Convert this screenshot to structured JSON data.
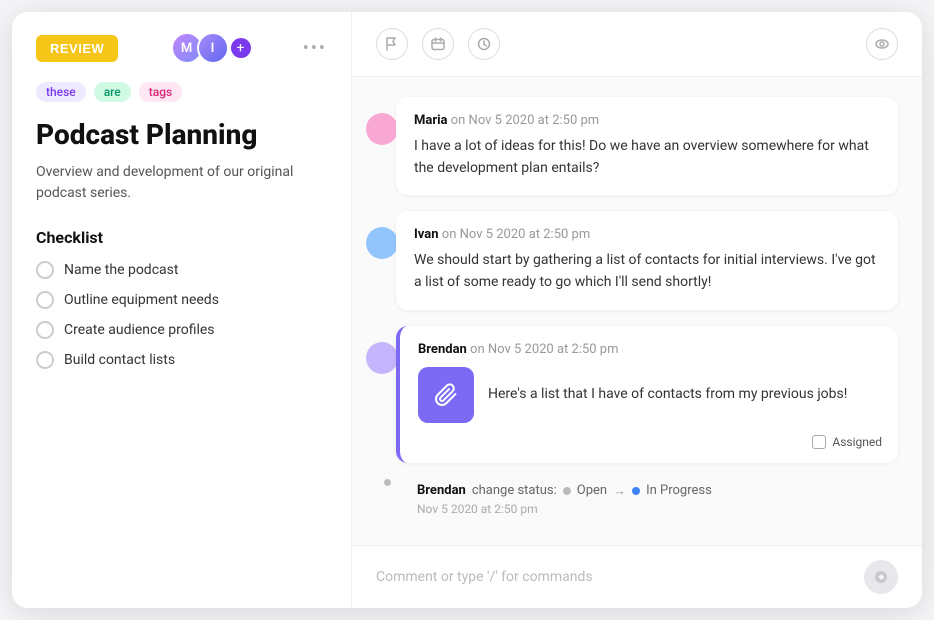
{
  "leftPanel": {
    "reviewButton": "REVIEW",
    "tags": [
      {
        "label": "these",
        "type": "purple"
      },
      {
        "label": "are",
        "type": "green"
      },
      {
        "label": "tags",
        "type": "pink"
      }
    ],
    "title": "Podcast Planning",
    "description": "Overview and development of our original podcast series.",
    "checklist": {
      "title": "Checklist",
      "items": [
        "Name the podcast",
        "Outline equipment needs",
        "Create audience profiles",
        "Build contact lists"
      ]
    }
  },
  "rightPanel": {
    "comments": [
      {
        "author": "Maria",
        "meta": "on Nov 5 2020 at 2:50 pm",
        "text": "I have a lot of ideas for this! Do we have an overview somewhere for what the development plan entails?",
        "dotColor": "pink",
        "hasAttachment": false,
        "highlighted": false
      },
      {
        "author": "Ivan",
        "meta": "on Nov 5 2020 at 2:50 pm",
        "text": "We should start by gathering a list of contacts for initial interviews. I've got a list of some ready to go which I'll send shortly!",
        "dotColor": "blue",
        "hasAttachment": false,
        "highlighted": false
      },
      {
        "author": "Brendan",
        "meta": "on Nov 5 2020 at 2:50 pm",
        "text": "Here's a list that I have of contacts from my previous jobs!",
        "dotColor": "purple",
        "hasAttachment": true,
        "highlighted": true,
        "assignedLabel": "Assigned"
      }
    ],
    "statusChange": {
      "author": "Brendan",
      "action": "change status:",
      "from": "Open",
      "to": "In Progress",
      "time": "Nov 5 2020 at 2:50 pm"
    },
    "commentPlaceholder": "Comment or type '/' for commands"
  },
  "icons": {
    "flag": "⚑",
    "calendar": "▭",
    "clock": "◷",
    "eye": "◉",
    "paperclip": "🔗",
    "chat": "💬"
  }
}
